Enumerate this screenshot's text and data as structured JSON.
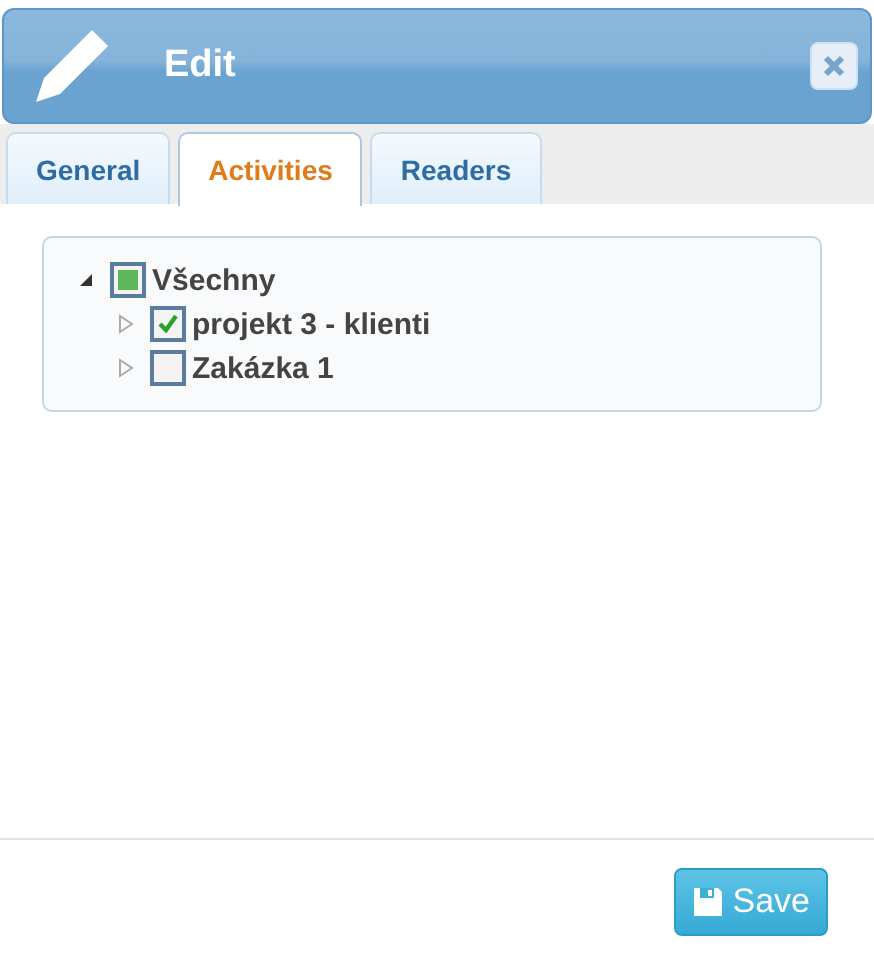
{
  "window": {
    "title": "Edit"
  },
  "tabs": [
    {
      "label": "General",
      "selected": false
    },
    {
      "label": "Activities",
      "selected": true
    },
    {
      "label": "Readers",
      "selected": false
    }
  ],
  "tree": [
    {
      "label": "Všechny",
      "checked": false,
      "partial": true,
      "expanded": true,
      "children": [
        {
          "label": "projekt 3 - klienti",
          "checked": true,
          "partial": false,
          "expanded": false
        },
        {
          "label": "Zakázka 1",
          "checked": false,
          "partial": false,
          "expanded": false
        }
      ]
    }
  ],
  "buttons": [
    {
      "label": "Save"
    }
  ]
}
